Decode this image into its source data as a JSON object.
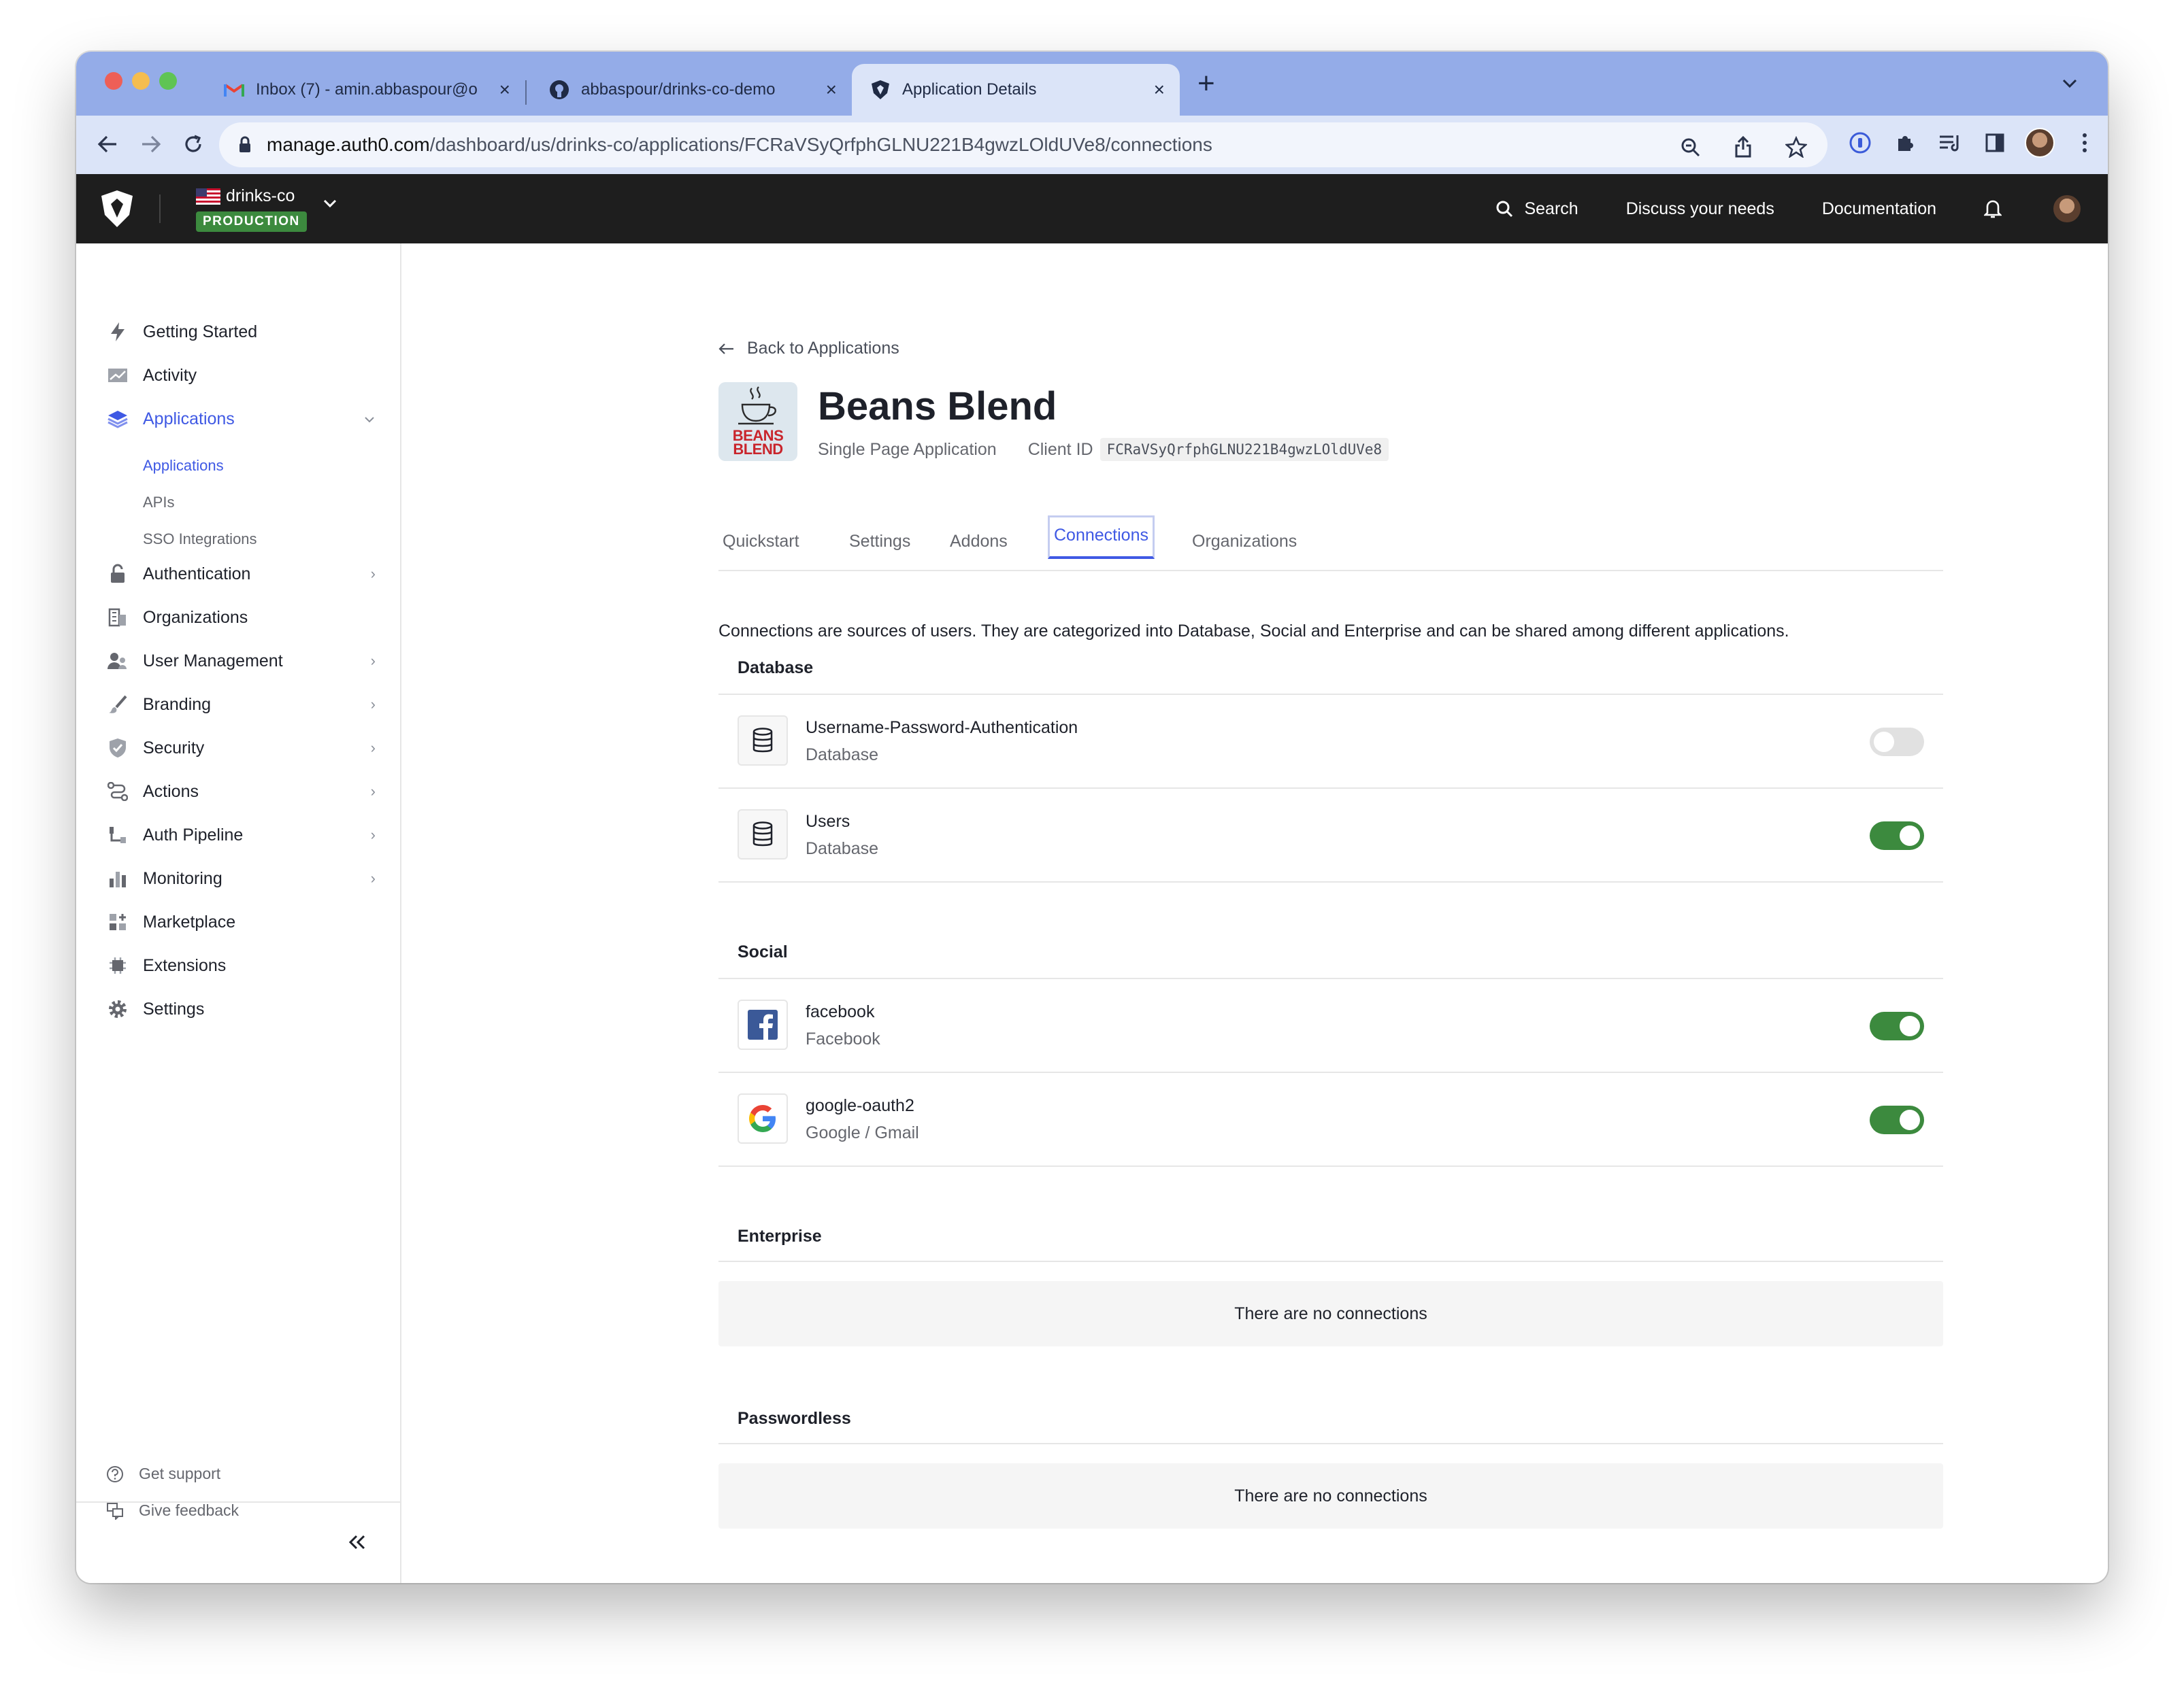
{
  "browser": {
    "tabs": [
      {
        "label": "Inbox (7) - amin.abbaspour@o",
        "icon": "gmail-icon"
      },
      {
        "label": "abbaspour/drinks-co-demo",
        "icon": "github-icon"
      },
      {
        "label": "Application Details",
        "icon": "auth0-icon",
        "active": true
      }
    ],
    "url_host": "manage.auth0.com",
    "url_path": "/dashboard/us/drinks-co/applications/FCRaVSyQrfphGLNU221B4gwzLOldUVe8/connections"
  },
  "header": {
    "tenant_name": "drinks-co",
    "environment_badge": "PRODUCTION",
    "search_label": "Search",
    "discuss_label": "Discuss your needs",
    "docs_label": "Documentation"
  },
  "sidebar": {
    "items": [
      {
        "label": "Getting Started"
      },
      {
        "label": "Activity"
      },
      {
        "label": "Applications"
      },
      {
        "label": "Authentication"
      },
      {
        "label": "Organizations"
      },
      {
        "label": "User Management"
      },
      {
        "label": "Branding"
      },
      {
        "label": "Security"
      },
      {
        "label": "Actions"
      },
      {
        "label": "Auth Pipeline"
      },
      {
        "label": "Monitoring"
      },
      {
        "label": "Marketplace"
      },
      {
        "label": "Extensions"
      },
      {
        "label": "Settings"
      }
    ],
    "subitems": [
      {
        "label": "Applications"
      },
      {
        "label": "APIs"
      },
      {
        "label": "SSO Integrations"
      }
    ],
    "footer": {
      "support": "Get support",
      "feedback": "Give feedback"
    }
  },
  "app": {
    "back_label": "Back to Applications",
    "logo_line1": "BEANS",
    "logo_line2": "BLEND",
    "name": "Beans Blend",
    "type": "Single Page Application",
    "client_id_label": "Client ID",
    "client_id": "FCRaVSyQrfphGLNU221B4gwzLOldUVe8"
  },
  "tabs": [
    {
      "label": "Quickstart"
    },
    {
      "label": "Settings"
    },
    {
      "label": "Addons"
    },
    {
      "label": "Connections",
      "active": true
    },
    {
      "label": "Organizations"
    }
  ],
  "connections": {
    "intro": "Connections are sources of users. They are categorized into Database, Social and Enterprise and can be shared among different applications.",
    "database": {
      "title": "Database",
      "items": [
        {
          "name": "Username-Password-Authentication",
          "type": "Database",
          "enabled": false
        },
        {
          "name": "Users",
          "type": "Database",
          "enabled": true
        }
      ]
    },
    "social": {
      "title": "Social",
      "items": [
        {
          "name": "facebook",
          "type": "Facebook",
          "enabled": true
        },
        {
          "name": "google-oauth2",
          "type": "Google / Gmail",
          "enabled": true
        }
      ]
    },
    "enterprise": {
      "title": "Enterprise",
      "empty": "There are no connections"
    },
    "passwordless": {
      "title": "Passwordless",
      "empty": "There are no connections"
    }
  },
  "colors": {
    "accent": "#3f59e4",
    "toggle_on": "#3c8a3e",
    "badge": "#3c8a3e",
    "header_bg": "#1e1e1e",
    "tabstrip": "#94ace8"
  }
}
